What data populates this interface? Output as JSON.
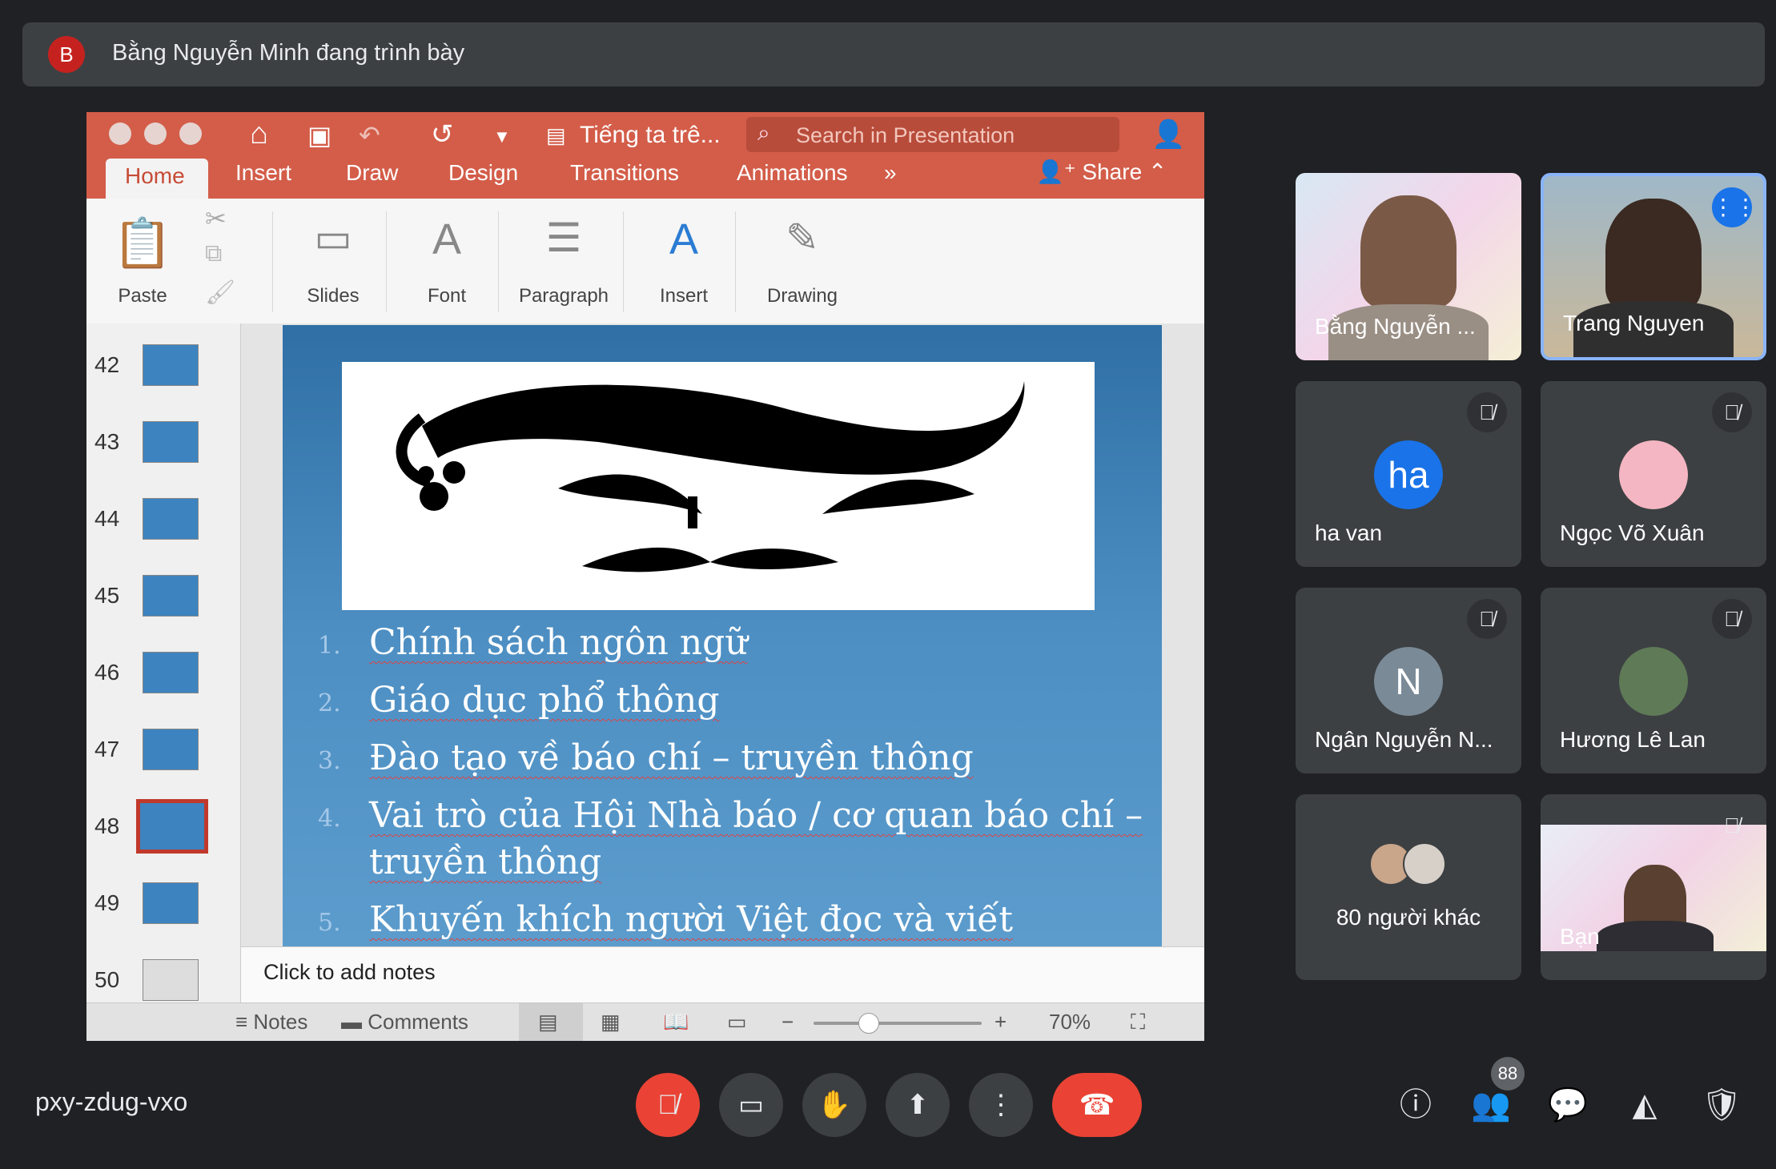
{
  "banner": {
    "avatar_letter": "B",
    "text": "Bằng Nguyễn Minh đang trình bày"
  },
  "ppt": {
    "doc_title": "Tiếng ta trê...",
    "search_placeholder": "Search in Presentation",
    "tabs": [
      "Home",
      "Insert",
      "Draw",
      "Design",
      "Transitions",
      "Animations"
    ],
    "more": "»",
    "share_label": "Share",
    "ribbon": {
      "paste": "Paste",
      "slides": "Slides",
      "font": "Font",
      "paragraph": "Paragraph",
      "insert": "Insert",
      "drawing": "Drawing"
    },
    "thumbnails": [
      "42",
      "43",
      "44",
      "45",
      "46",
      "47",
      "48",
      "49",
      "50"
    ],
    "selected_slide": "48",
    "slide_items": [
      {
        "n": "1.",
        "text": "Chính sách ngôn ngữ"
      },
      {
        "n": "2.",
        "text": "Giáo dục phổ thông"
      },
      {
        "n": "3.",
        "text": "Đào tạo về báo chí – truyền thông"
      },
      {
        "n": "4.",
        "text": "Vai trò của Hội Nhà báo / cơ quan báo chí – truyền thông"
      },
      {
        "n": "5.",
        "text": "Khuyến khích người Việt đọc và viết"
      }
    ],
    "notes_placeholder": "Click to add notes",
    "status": {
      "notes": "Notes",
      "comments": "Comments",
      "zoom": "70%",
      "minus": "−",
      "plus": "+"
    }
  },
  "participants": [
    {
      "name": "Bằng Nguyễn ...",
      "type": "video"
    },
    {
      "name": "Trang Nguyen",
      "type": "video",
      "speaking": true
    },
    {
      "name": "ha van",
      "avatar": "ha",
      "color": "#1a73e8"
    },
    {
      "name": "Ngọc Võ Xuân",
      "avatar": "",
      "color": "#f4b6c2"
    },
    {
      "name": "Ngân Nguyễn N...",
      "avatar": "N",
      "color": "#7b8a97"
    },
    {
      "name": "Hương Lê Lan",
      "avatar": "",
      "color": "#5f7a56"
    },
    {
      "name": "80 người khác",
      "type": "others"
    },
    {
      "name": "Bạn",
      "type": "video"
    }
  ],
  "bottom": {
    "meeting_code": "pxy-zdug-vxo",
    "people_count": "88"
  },
  "colors": {
    "accent_red": "#ea4335",
    "ppt_title": "#d35d49",
    "bg": "#202124"
  }
}
